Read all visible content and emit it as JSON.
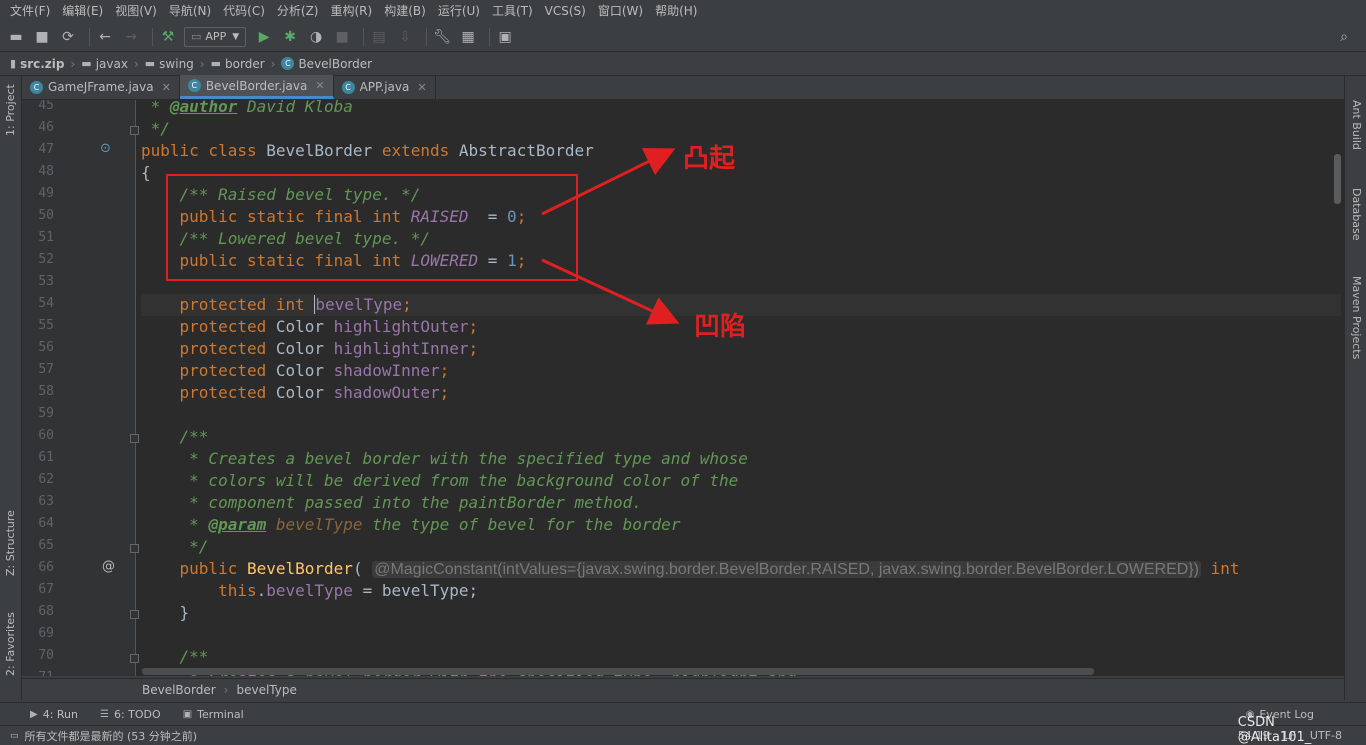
{
  "menu": [
    "文件(F)",
    "编辑(E)",
    "视图(V)",
    "导航(N)",
    "代码(C)",
    "分析(Z)",
    "重构(R)",
    "构建(B)",
    "运行(U)",
    "工具(T)",
    "VCS(S)",
    "窗口(W)",
    "帮助(H)"
  ],
  "toolbar": {
    "run_config": "APP"
  },
  "breadcrumb": [
    "src.zip",
    "javax",
    "swing",
    "border",
    "BevelBorder"
  ],
  "tabs": [
    {
      "label": "GameJFrame.java"
    },
    {
      "label": "BevelBorder.java"
    },
    {
      "label": "APP.java"
    }
  ],
  "left_tools": [
    "1: Project",
    "Z: Structure",
    "2: Favorites"
  ],
  "right_tools": [
    "Ant Build",
    "Database",
    "Maven Projects"
  ],
  "line_numbers": [
    "45",
    "46",
    "47",
    "48",
    "49",
    "50",
    "51",
    "52",
    "53",
    "54",
    "55",
    "56",
    "57",
    "58",
    "59",
    "60",
    "61",
    "62",
    "63",
    "64",
    "65",
    "66",
    "67",
    "68",
    "69",
    "70",
    "71"
  ],
  "code": {
    "l45_tag": "@author",
    "l45_text": " David Kloba",
    "l46": " */",
    "l47_a": "public class ",
    "l47_b": "BevelBorder ",
    "l47_c": "extends ",
    "l47_d": "AbstractBorder",
    "l48": "{",
    "l49": "    /** Raised bevel type. */",
    "l50_kw": "    public static final int ",
    "l50_fld": "RAISED",
    "l50_eq": "  = ",
    "l50_num": "0",
    "l51": "    /** Lowered bevel type. */",
    "l52_kw": "    public static final int ",
    "l52_fld": "LOWERED",
    "l52_eq": " = ",
    "l52_num": "1",
    "l54_kw": "    protected int ",
    "l54_fld": "bevelType",
    "l55_type": "Color ",
    "l55_fld": "highlightOuter",
    "l56_fld": "highlightInner",
    "l57_fld": "shadowInner",
    "l58_fld": "shadowOuter",
    "protected": "    protected ",
    "l60": "    /**",
    "l61": "     * Creates a bevel border with the specified type and whose",
    "l62": "     * colors will be derived from the background color of the",
    "l63": "     * component passed into the paintBorder method.",
    "l64_pre": "     * ",
    "l64_tag": "@param",
    "l64_param": " bevelType",
    "l64_rest": " the type of bevel for the border",
    "l65": "     */",
    "l66_kw": "    public ",
    "l66_mth": "BevelBorder",
    "l66_paren": "( ",
    "l66_hint": "@MagicConstant(intValues={javax.swing.border.BevelBorder.RAISED, javax.swing.border.BevelBorder.LOWERED})",
    "l66_int": " int",
    "l67_kw": "        this",
    "l67_dot": ".",
    "l67_fld": "bevelType",
    "l67_rest": " = bevelType;",
    "l68": "    }",
    "l70": "    /**",
    "l71": "     * Creates a bevel border with the specified type, highlight and"
  },
  "annotations": {
    "raised": "凸起",
    "lowered": "凹陷"
  },
  "editor_breadcrumb": [
    "BevelBorder",
    "bevelType"
  ],
  "tool_windows": [
    "4: Run",
    "6: TODO",
    "Terminal"
  ],
  "event_log": "Event Log",
  "status": {
    "message": "所有文件都是最新的 (53 分钟之前)",
    "position": "54:19",
    "line_sep": "LF",
    "encoding": "UTF-8",
    "watermark": "CSDN @Alita101_"
  },
  "colors": {
    "annotation_red": "#e02020",
    "keyword": "#cc7832",
    "comment": "#629755",
    "field": "#9876aa",
    "number": "#6897bb"
  }
}
